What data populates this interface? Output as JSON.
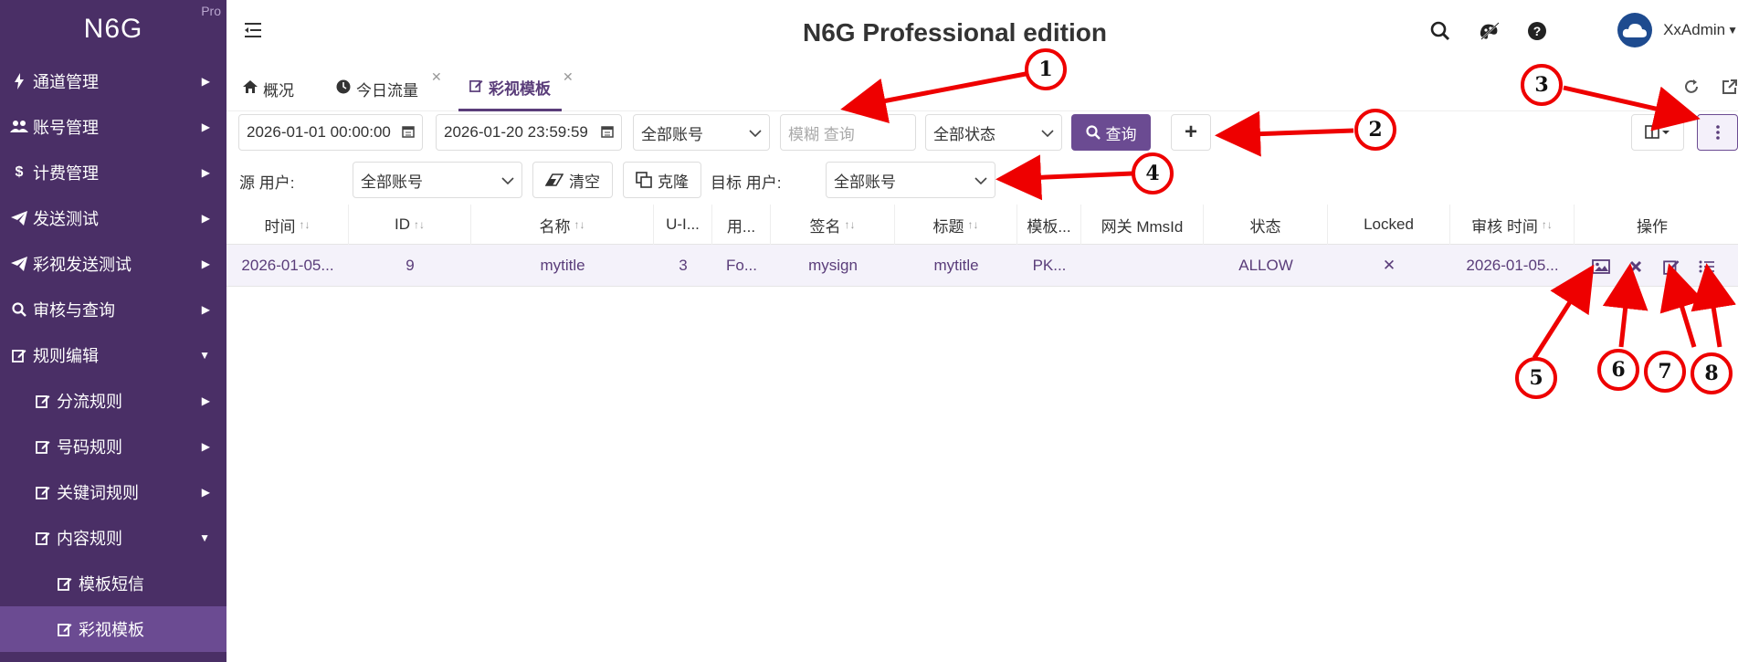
{
  "brand": {
    "logo": "N6G",
    "badge": "Pro"
  },
  "sidebar": {
    "items": [
      {
        "label": "通道管理",
        "icon": "bolt-icon"
      },
      {
        "label": "账号管理",
        "icon": "users-icon"
      },
      {
        "label": "计费管理",
        "icon": "dollar-icon"
      },
      {
        "label": "发送测试",
        "icon": "paper-plane-icon"
      },
      {
        "label": "彩视发送测试",
        "icon": "paper-plane-icon"
      },
      {
        "label": "审核与查询",
        "icon": "search-icon"
      },
      {
        "label": "规则编辑",
        "icon": "edit-icon"
      },
      {
        "label": "分流规则",
        "icon": "edit-icon"
      },
      {
        "label": "号码规则",
        "icon": "edit-icon"
      },
      {
        "label": "关键词规则",
        "icon": "edit-icon"
      },
      {
        "label": "内容规则",
        "icon": "edit-icon"
      },
      {
        "label": "模板短信",
        "icon": "edit-icon"
      },
      {
        "label": "彩视模板",
        "icon": "edit-icon"
      }
    ]
  },
  "header": {
    "title": "N6G Professional edition",
    "user": "XxAdmin"
  },
  "tabs": [
    {
      "label": "概况",
      "icon": "home-icon"
    },
    {
      "label": "今日流量",
      "icon": "clock-icon"
    },
    {
      "label": "彩视模板",
      "icon": "edit-icon"
    }
  ],
  "toolbar": {
    "start_time": "2026-01-01 00:00:00",
    "end_time": "2026-01-20 23:59:59",
    "account": "全部账号",
    "search_placeholder": "模糊 查询",
    "status": "全部状态",
    "query_label": "查询",
    "add_label": "+"
  },
  "toolbar2": {
    "source_user_label": "源 用户:",
    "source_user_value": "全部账号",
    "clear_label": "清空",
    "clone_label": "克隆",
    "target_user_label": "目标 用户:",
    "target_user_value": "全部账号"
  },
  "table": {
    "columns": [
      "时间",
      "ID",
      "名称",
      "U-I...",
      "用...",
      "签名",
      "标题",
      "模板...",
      "网关 MmsId",
      "状态",
      "Locked",
      "审核 时间",
      "操作"
    ],
    "rows": [
      {
        "time": "2026-01-05...",
        "id": "9",
        "name": "mytitle",
        "ui": "3",
        "usage": "Fo...",
        "sign": "mysign",
        "title": "mytitle",
        "template": "PK...",
        "mmsid": "",
        "status": "ALLOW",
        "locked": "✕",
        "review_time": "2026-01-05..."
      }
    ]
  },
  "annotations": [
    "1",
    "2",
    "3",
    "4",
    "5",
    "6",
    "7",
    "8"
  ],
  "colors": {
    "sidebar": "#4a2f66",
    "accent": "#6b4b92",
    "arrow": "#ee0000"
  }
}
